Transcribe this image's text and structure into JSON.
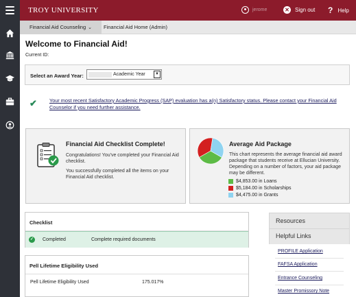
{
  "header": {
    "brand": "TROY UNIVERSITY",
    "user_name": "jerome",
    "signout_label": "Sign out",
    "help_label": "Help"
  },
  "nav": {
    "icons": [
      "home-icon",
      "institution-icon",
      "graduation-cap-icon",
      "briefcase-icon",
      "user-circle-icon"
    ]
  },
  "breadcrumb": {
    "parent": "Financial Aid Counseling",
    "current": "Financial Aid Home (Admin)"
  },
  "main": {
    "title": "Welcome to Financial Aid!",
    "current_id_label": "Current ID:"
  },
  "award": {
    "label": "Select an Award Year:",
    "selected": "Academic Year"
  },
  "sap": {
    "message": "Your most recent Satisfactory Academic Progress (SAP) evaluation has a(n) Satisfactory status. Please contact your Financial Aid Counselor if you need further assistance."
  },
  "checklist_card": {
    "title": "Financial Aid Checklist Complete!",
    "line1": "Congratulations! You've completed your Financial Aid checklist.",
    "line2": "You successfully completed all the items on your Financial Aid checklist."
  },
  "aid_card": {
    "title": "Average Aid Package",
    "description": "This chart represents the average financial aid award package that students receive at Ellucian University. Depending on a number of factors, your aid package may be different.",
    "legend": [
      {
        "label": "$4,853.00 in Loans",
        "color": "#5dbb46"
      },
      {
        "label": "$5,184.00 in Scholarships",
        "color": "#d32020"
      },
      {
        "label": "$4,475.00 in Grants",
        "color": "#8fd3f0"
      }
    ]
  },
  "checklist_panel": {
    "title": "Checklist",
    "status": "Completed",
    "item": "Complete required documents"
  },
  "pell_panel": {
    "title": "Pell Lifetime Eligibility Used",
    "label": "Pell Lifetime Eligibility Used",
    "value": "175.017%"
  },
  "sidebar": {
    "resources": "Resources",
    "helpful_links": "Helpful Links",
    "links": [
      "PROFILE Application",
      "FAFSA Application",
      "Entrance Counseling",
      "Master Promissory Note"
    ]
  },
  "chart_data": {
    "type": "pie",
    "title": "Average Aid Package",
    "categories": [
      "Loans",
      "Scholarships",
      "Grants"
    ],
    "values": [
      4853.0,
      5184.0,
      4475.0
    ],
    "colors": [
      "#5dbb46",
      "#d32020",
      "#8fd3f0"
    ]
  }
}
